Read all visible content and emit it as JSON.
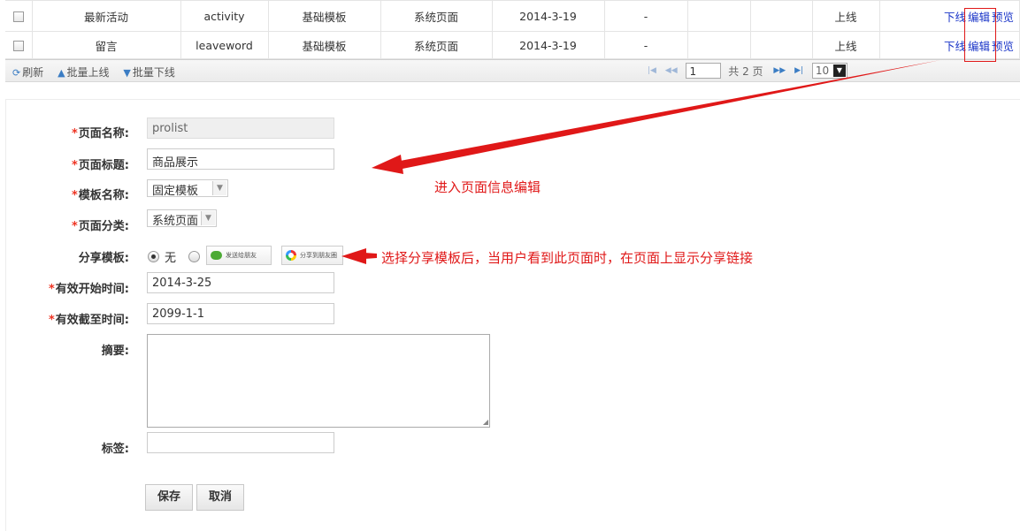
{
  "table": {
    "rows": [
      {
        "name": "最新活动",
        "code": "activity",
        "template": "基础模板",
        "category": "系统页面",
        "date": "2014-3-19",
        "dash": "-",
        "status": "上线",
        "actions": [
          "下线",
          "编辑",
          "预览"
        ]
      },
      {
        "name": "留言",
        "code": "leaveword",
        "template": "基础模板",
        "category": "系统页面",
        "date": "2014-3-19",
        "dash": "-",
        "status": "上线",
        "actions": [
          "下线",
          "编辑",
          "预览"
        ]
      }
    ]
  },
  "toolbar": {
    "refresh": "刷新",
    "batch_online": "批量上线",
    "batch_offline": "批量下线",
    "page_value": "1",
    "total_pages": "共 2 页",
    "page_size": "10"
  },
  "form": {
    "page_name": {
      "label": "页面名称:",
      "value": "prolist"
    },
    "page_title": {
      "label": "页面标题:",
      "value": "商品展示"
    },
    "template_name": {
      "label": "模板名称:",
      "value": "固定模板"
    },
    "page_category": {
      "label": "页面分类:",
      "value": "系统页面"
    },
    "share_template": {
      "label": "分享模板:",
      "none": "无",
      "option_wechat": "发送给朋友",
      "option_moments": "分享到朋友圈"
    },
    "start_time": {
      "label": "有效开始时间:",
      "value": "2014-3-25"
    },
    "end_time": {
      "label": "有效截至时间:",
      "value": "2099-1-1"
    },
    "summary": {
      "label": "摘要:",
      "value": ""
    },
    "tags": {
      "label": "标签:",
      "value": ""
    },
    "save": "保存",
    "cancel": "取消"
  },
  "annotations": {
    "edit_note": "进入页面信息编辑",
    "share_note": "选择分享模板后，当用户看到此页面时，在页面上显示分享链接"
  },
  "colors": {
    "annotation": "#e01818",
    "online": "#2a8a2a",
    "link": "#1a35c8"
  },
  "icons": [
    "refresh-icon",
    "arrow-up-icon",
    "arrow-down-icon",
    "first-page-icon",
    "prev-page-icon",
    "next-page-icon",
    "last-page-icon",
    "chevron-down-icon",
    "wechat-icon",
    "moments-icon"
  ]
}
